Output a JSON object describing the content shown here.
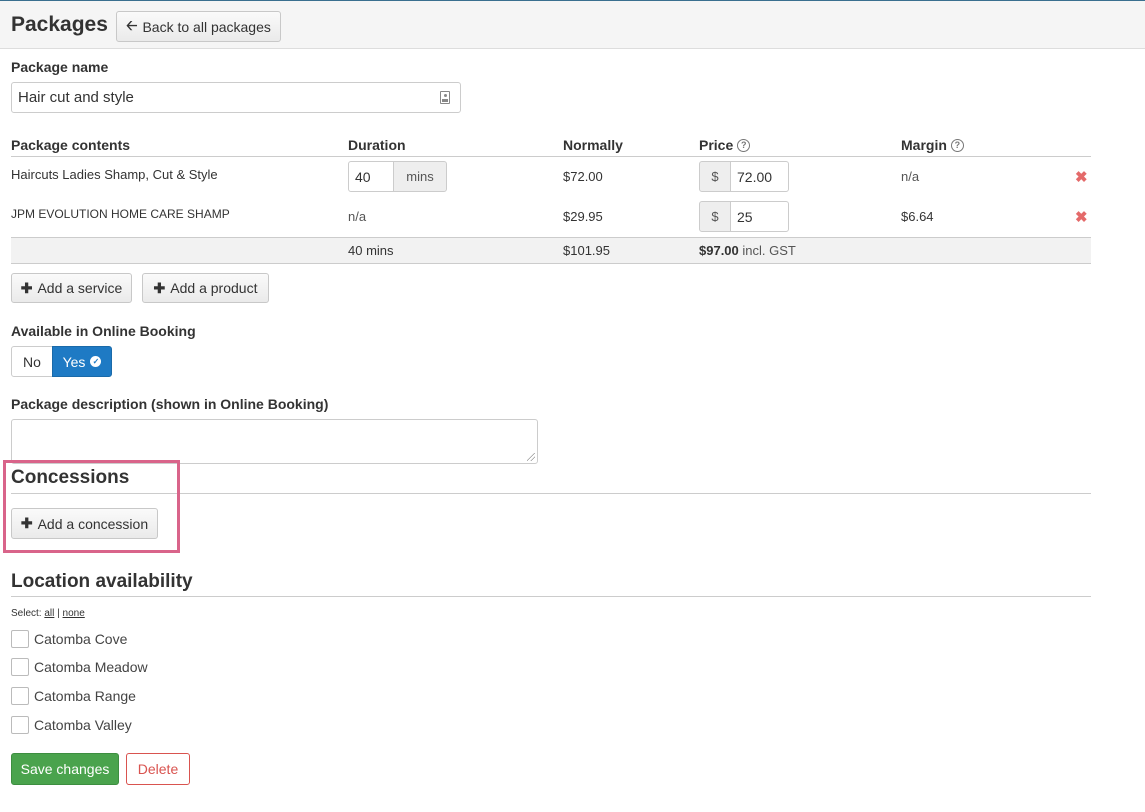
{
  "header": {
    "title": "Packages",
    "back_label": "Back to all packages"
  },
  "package_name": {
    "label": "Package name",
    "value": "Hair cut and style"
  },
  "contents": {
    "columns": {
      "contents": "Package contents",
      "duration": "Duration",
      "normally": "Normally",
      "price": "Price",
      "margin": "Margin"
    },
    "rows": [
      {
        "name": "Haircuts Ladies Shamp, Cut & Style",
        "duration_value": "40",
        "duration_unit": "mins",
        "normally": "$72.00",
        "currency": "$",
        "price": "72.00",
        "margin": "n/a"
      },
      {
        "name": "JPM EVOLUTION HOME CARE SHAMP",
        "duration_text": "n/a",
        "normally": "$29.95",
        "currency": "$",
        "price": "25",
        "margin": "$6.64"
      }
    ],
    "totals": {
      "duration": "40 mins",
      "normally": "$101.95",
      "price": "$97.00",
      "price_suffix": "incl. GST"
    },
    "add_service": "Add a service",
    "add_product": "Add a product"
  },
  "online_booking": {
    "label": "Available in Online Booking",
    "no": "No",
    "yes": "Yes",
    "selected": "Yes"
  },
  "description": {
    "label": "Package description (shown in Online Booking)",
    "value": ""
  },
  "concessions": {
    "title": "Concessions",
    "add_label": "Add a concession"
  },
  "locations": {
    "title": "Location availability",
    "select_prefix": "Select:",
    "select_all": "all",
    "select_separator": "|",
    "select_none": "none",
    "items": [
      {
        "label": "Catomba Cove",
        "checked": false
      },
      {
        "label": "Catomba Meadow",
        "checked": false
      },
      {
        "label": "Catomba Range",
        "checked": false
      },
      {
        "label": "Catomba Valley",
        "checked": false
      }
    ]
  },
  "actions": {
    "save": "Save changes",
    "delete": "Delete"
  },
  "colors": {
    "primary": "#1e7ac4",
    "success": "#4aa34d",
    "danger": "#d9534f",
    "highlight": "#d9648a"
  }
}
